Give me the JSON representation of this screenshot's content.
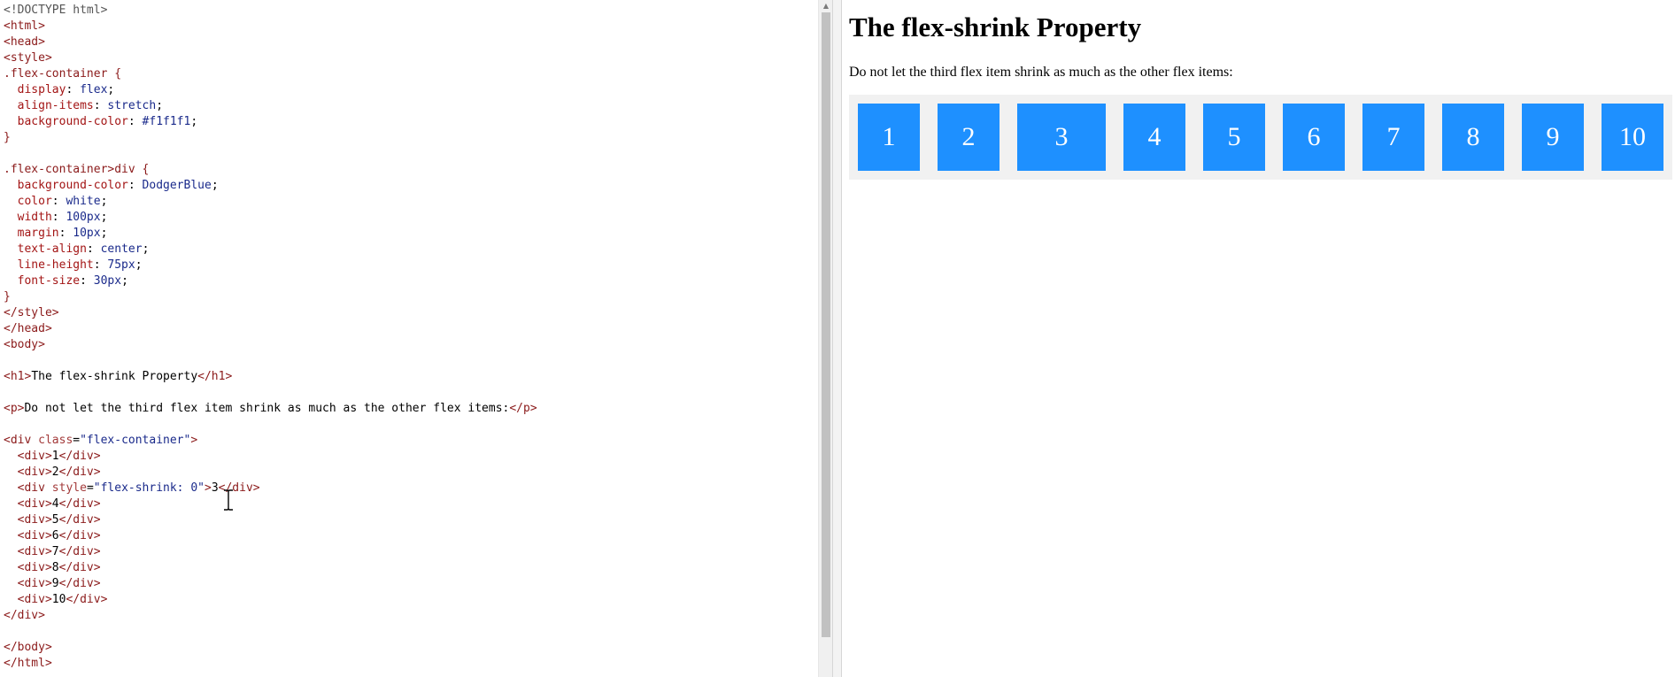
{
  "editor": {
    "lines": [
      [
        {
          "t": "doc",
          "v": "<!DOCTYPE html>"
        }
      ],
      [
        {
          "t": "tag",
          "v": "<html>"
        }
      ],
      [
        {
          "t": "tag",
          "v": "<head>"
        }
      ],
      [
        {
          "t": "tag",
          "v": "<style>"
        }
      ],
      [
        {
          "t": "sel",
          "v": ".flex-container {"
        }
      ],
      [
        {
          "t": "text",
          "v": "  "
        },
        {
          "t": "prop",
          "v": "display"
        },
        {
          "t": "text",
          "v": ": "
        },
        {
          "t": "pv",
          "v": "flex"
        },
        {
          "t": "text",
          "v": ";"
        }
      ],
      [
        {
          "t": "text",
          "v": "  "
        },
        {
          "t": "prop",
          "v": "align-items"
        },
        {
          "t": "text",
          "v": ": "
        },
        {
          "t": "pv",
          "v": "stretch"
        },
        {
          "t": "text",
          "v": ";"
        }
      ],
      [
        {
          "t": "text",
          "v": "  "
        },
        {
          "t": "prop",
          "v": "background-color"
        },
        {
          "t": "text",
          "v": ": "
        },
        {
          "t": "pv",
          "v": "#f1f1f1"
        },
        {
          "t": "text",
          "v": ";"
        }
      ],
      [
        {
          "t": "sel",
          "v": "}"
        }
      ],
      [
        {
          "t": "text",
          "v": ""
        }
      ],
      [
        {
          "t": "sel",
          "v": ".flex-container>div {"
        }
      ],
      [
        {
          "t": "text",
          "v": "  "
        },
        {
          "t": "prop",
          "v": "background-color"
        },
        {
          "t": "text",
          "v": ": "
        },
        {
          "t": "pv",
          "v": "DodgerBlue"
        },
        {
          "t": "text",
          "v": ";"
        }
      ],
      [
        {
          "t": "text",
          "v": "  "
        },
        {
          "t": "prop",
          "v": "color"
        },
        {
          "t": "text",
          "v": ": "
        },
        {
          "t": "pv",
          "v": "white"
        },
        {
          "t": "text",
          "v": ";"
        }
      ],
      [
        {
          "t": "text",
          "v": "  "
        },
        {
          "t": "prop",
          "v": "width"
        },
        {
          "t": "text",
          "v": ": "
        },
        {
          "t": "pv",
          "v": "100px"
        },
        {
          "t": "text",
          "v": ";"
        }
      ],
      [
        {
          "t": "text",
          "v": "  "
        },
        {
          "t": "prop",
          "v": "margin"
        },
        {
          "t": "text",
          "v": ": "
        },
        {
          "t": "pv",
          "v": "10px"
        },
        {
          "t": "text",
          "v": ";"
        }
      ],
      [
        {
          "t": "text",
          "v": "  "
        },
        {
          "t": "prop",
          "v": "text-align"
        },
        {
          "t": "text",
          "v": ": "
        },
        {
          "t": "pv",
          "v": "center"
        },
        {
          "t": "text",
          "v": ";"
        }
      ],
      [
        {
          "t": "text",
          "v": "  "
        },
        {
          "t": "prop",
          "v": "line-height"
        },
        {
          "t": "text",
          "v": ": "
        },
        {
          "t": "pv",
          "v": "75px"
        },
        {
          "t": "text",
          "v": ";"
        }
      ],
      [
        {
          "t": "text",
          "v": "  "
        },
        {
          "t": "prop",
          "v": "font-size"
        },
        {
          "t": "text",
          "v": ": "
        },
        {
          "t": "pv",
          "v": "30px"
        },
        {
          "t": "text",
          "v": ";"
        }
      ],
      [
        {
          "t": "sel",
          "v": "}"
        }
      ],
      [
        {
          "t": "tag",
          "v": "</style>"
        }
      ],
      [
        {
          "t": "tag",
          "v": "</head>"
        }
      ],
      [
        {
          "t": "tag",
          "v": "<body>"
        }
      ],
      [
        {
          "t": "text",
          "v": ""
        }
      ],
      [
        {
          "t": "tag",
          "v": "<h1>"
        },
        {
          "t": "text",
          "v": "The flex-shrink Property"
        },
        {
          "t": "tag",
          "v": "</h1>"
        }
      ],
      [
        {
          "t": "text",
          "v": ""
        }
      ],
      [
        {
          "t": "tag",
          "v": "<p>"
        },
        {
          "t": "text",
          "v": "Do not let the third flex item shrink as much as the other flex items:"
        },
        {
          "t": "tag",
          "v": "</p>"
        }
      ],
      [
        {
          "t": "text",
          "v": ""
        }
      ],
      [
        {
          "t": "tag",
          "v": "<div "
        },
        {
          "t": "attr",
          "v": "class"
        },
        {
          "t": "text",
          "v": "="
        },
        {
          "t": "val",
          "v": "\"flex-container\""
        },
        {
          "t": "tag",
          "v": ">"
        }
      ],
      [
        {
          "t": "text",
          "v": "  "
        },
        {
          "t": "tag",
          "v": "<div>"
        },
        {
          "t": "text",
          "v": "1"
        },
        {
          "t": "tag",
          "v": "</div>"
        }
      ],
      [
        {
          "t": "text",
          "v": "  "
        },
        {
          "t": "tag",
          "v": "<div>"
        },
        {
          "t": "text",
          "v": "2"
        },
        {
          "t": "tag",
          "v": "</div>"
        }
      ],
      [
        {
          "t": "text",
          "v": "  "
        },
        {
          "t": "tag",
          "v": "<div "
        },
        {
          "t": "attr",
          "v": "style"
        },
        {
          "t": "text",
          "v": "="
        },
        {
          "t": "val",
          "v": "\"flex-shrink: 0\""
        },
        {
          "t": "tag",
          "v": ">"
        },
        {
          "t": "text",
          "v": "3"
        },
        {
          "t": "tag",
          "v": "</div>"
        }
      ],
      [
        {
          "t": "text",
          "v": "  "
        },
        {
          "t": "tag",
          "v": "<div>"
        },
        {
          "t": "text",
          "v": "4"
        },
        {
          "t": "tag",
          "v": "</div>"
        }
      ],
      [
        {
          "t": "text",
          "v": "  "
        },
        {
          "t": "tag",
          "v": "<div>"
        },
        {
          "t": "text",
          "v": "5"
        },
        {
          "t": "tag",
          "v": "</div>"
        }
      ],
      [
        {
          "t": "text",
          "v": "  "
        },
        {
          "t": "tag",
          "v": "<div>"
        },
        {
          "t": "text",
          "v": "6"
        },
        {
          "t": "tag",
          "v": "</div>"
        }
      ],
      [
        {
          "t": "text",
          "v": "  "
        },
        {
          "t": "tag",
          "v": "<div>"
        },
        {
          "t": "text",
          "v": "7"
        },
        {
          "t": "tag",
          "v": "</div>"
        }
      ],
      [
        {
          "t": "text",
          "v": "  "
        },
        {
          "t": "tag",
          "v": "<div>"
        },
        {
          "t": "text",
          "v": "8"
        },
        {
          "t": "tag",
          "v": "</div>"
        }
      ],
      [
        {
          "t": "text",
          "v": "  "
        },
        {
          "t": "tag",
          "v": "<div>"
        },
        {
          "t": "text",
          "v": "9"
        },
        {
          "t": "tag",
          "v": "</div>"
        }
      ],
      [
        {
          "t": "text",
          "v": "  "
        },
        {
          "t": "tag",
          "v": "<div>"
        },
        {
          "t": "text",
          "v": "10"
        },
        {
          "t": "tag",
          "v": "</div>"
        }
      ],
      [
        {
          "t": "tag",
          "v": "</div>"
        }
      ],
      [
        {
          "t": "text",
          "v": ""
        }
      ],
      [
        {
          "t": "tag",
          "v": "</body>"
        }
      ],
      [
        {
          "t": "tag",
          "v": "</html>"
        }
      ]
    ],
    "cursor_icon": "text-cursor-icon"
  },
  "scrollbar": {
    "arrow_icon": "scroll-up-arrow-icon",
    "arrow_glyph": "▲"
  },
  "preview": {
    "title": "The flex-shrink Property",
    "paragraph": "Do not let the third flex item shrink as much as the other flex items:",
    "container_bg": "#f1f1f1",
    "item_bg": "#1e90ff",
    "items": [
      {
        "label": "1",
        "shrink": true
      },
      {
        "label": "2",
        "shrink": true
      },
      {
        "label": "3",
        "shrink": false
      },
      {
        "label": "4",
        "shrink": true
      },
      {
        "label": "5",
        "shrink": true
      },
      {
        "label": "6",
        "shrink": true
      },
      {
        "label": "7",
        "shrink": true
      },
      {
        "label": "8",
        "shrink": true
      },
      {
        "label": "9",
        "shrink": true
      },
      {
        "label": "10",
        "shrink": true
      }
    ]
  }
}
